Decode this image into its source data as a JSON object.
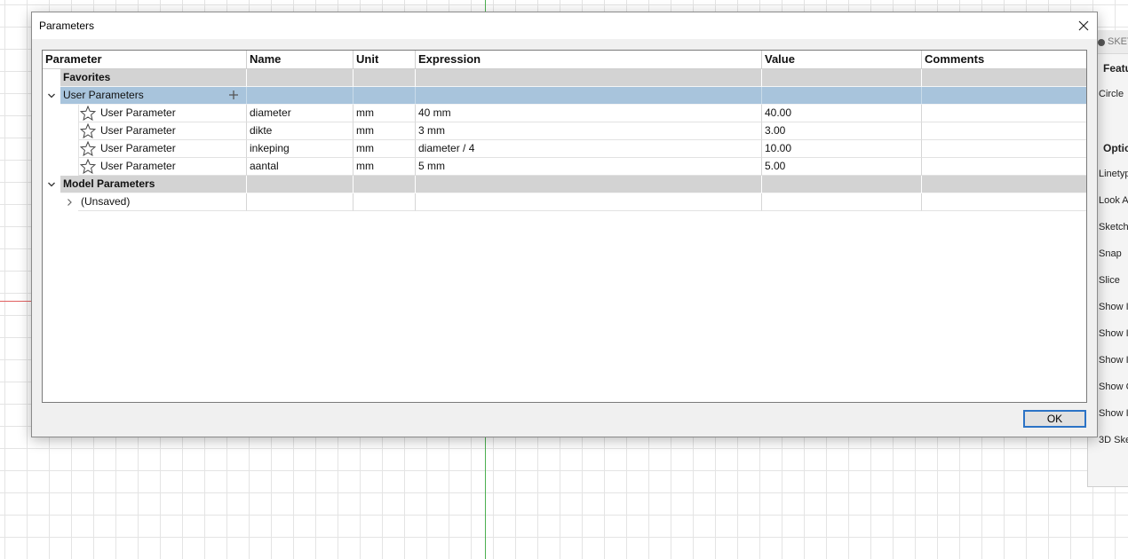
{
  "background": {
    "palette": {
      "header": "SKET",
      "items": [
        "Featu",
        "Circle",
        "Optio",
        "Linetyp",
        "Look A",
        "Sketch",
        "Snap",
        "Slice",
        "Show I",
        "Show I",
        "Show I",
        "Show C",
        "Show I",
        "3D Ske"
      ]
    }
  },
  "dialog": {
    "title": "Parameters",
    "ok_label": "OK",
    "columns": [
      "Parameter",
      "Name",
      "Unit",
      "Expression",
      "Value",
      "Comments"
    ],
    "favorites_label": "Favorites",
    "user_params_label": "User Parameters",
    "user_params": [
      {
        "type": "User Parameter",
        "name": "diameter",
        "unit": "mm",
        "expression": "40 mm",
        "value": "40.00",
        "comments": ""
      },
      {
        "type": "User Parameter",
        "name": "dikte",
        "unit": "mm",
        "expression": "3 mm",
        "value": "3.00",
        "comments": ""
      },
      {
        "type": "User Parameter",
        "name": "inkeping",
        "unit": "mm",
        "expression": "diameter / 4",
        "value": "10.00",
        "comments": ""
      },
      {
        "type": "User Parameter",
        "name": "aantal",
        "unit": "mm",
        "expression": "5 mm",
        "value": "5.00",
        "comments": ""
      }
    ],
    "model_params_label": "Model Parameters",
    "unsaved_label": "(Unsaved)"
  },
  "colors": {
    "selected_row": "#a8c4dc",
    "group_row": "#d3d3d3",
    "ok_border": "#2b73c6"
  }
}
